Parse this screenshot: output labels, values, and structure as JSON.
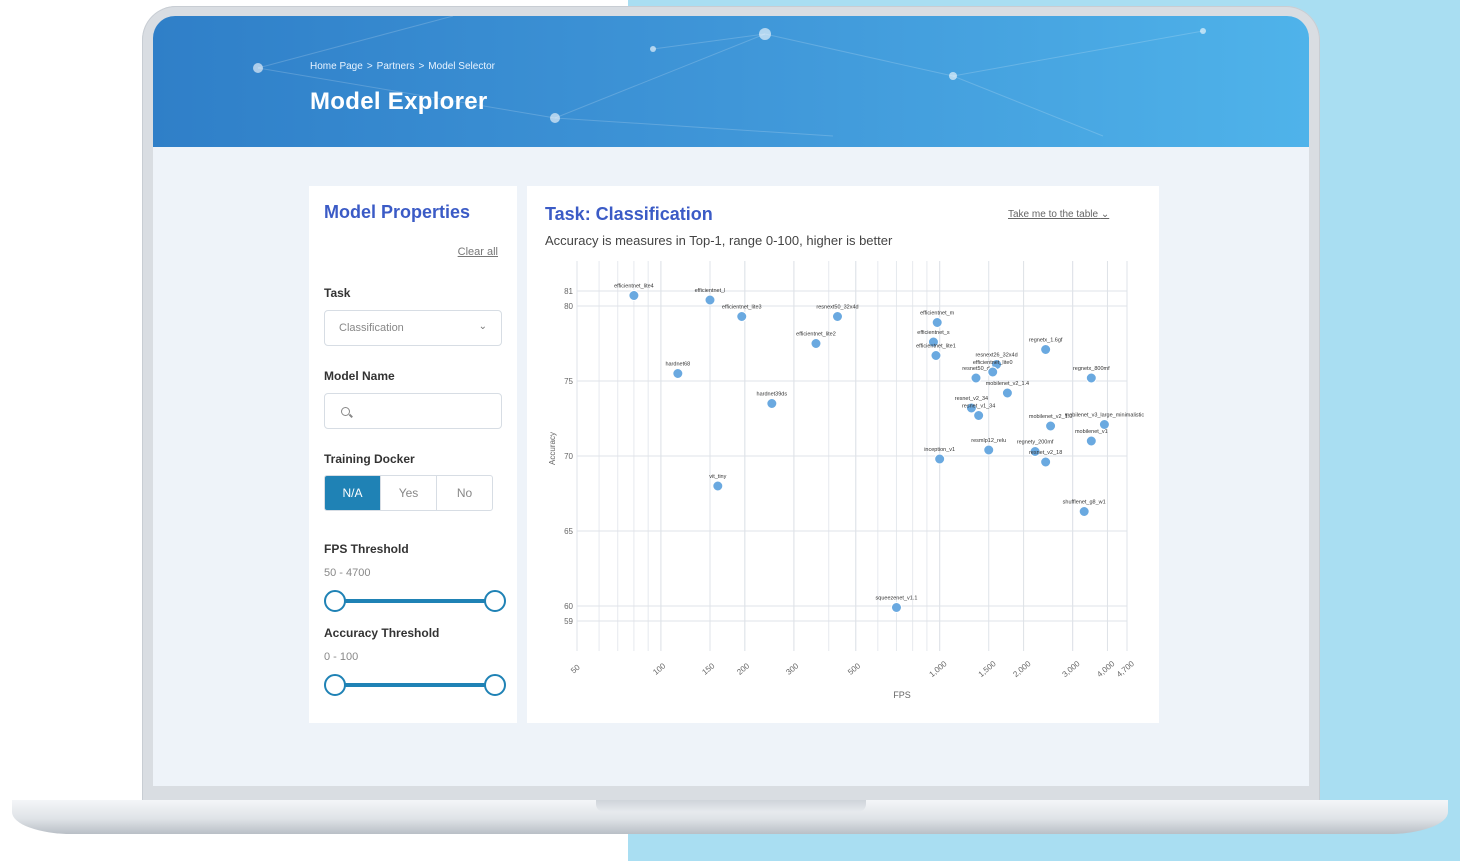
{
  "header": {
    "breadcrumb": [
      "Home Page",
      ">",
      "Partners",
      ">",
      "Model Selector"
    ],
    "title": "Model Explorer"
  },
  "sidebar": {
    "title": "Model Properties",
    "clear_all": "Clear all",
    "task_label": "Task",
    "task_value": "Classification",
    "model_name_label": "Model Name",
    "training_docker_label": "Training Docker",
    "docker_options": [
      "N/A",
      "Yes",
      "No"
    ],
    "docker_selected": "N/A",
    "fps_label": "FPS Threshold",
    "fps_range": "50 - 4700",
    "fps_min": 50,
    "fps_max": 4700,
    "accuracy_label": "Accuracy Threshold",
    "accuracy_range": "0 - 100",
    "accuracy_min": 0,
    "accuracy_max": 100
  },
  "main": {
    "task_title": "Task: Classification",
    "table_link": "Take me to the table",
    "subtitle": "Accuracy is measures in Top-1, range 0-100, higher is better"
  },
  "colors": {
    "accent": "#3b5bc6",
    "primary": "#1f82b5",
    "point": "#6aa9e0"
  },
  "icons": [
    "chevron-down-icon",
    "search-icon"
  ],
  "chart_data": {
    "type": "scatter",
    "xlabel": "FPS",
    "ylabel": "Accuracy",
    "x_scale": "log",
    "xlim": [
      50,
      4700
    ],
    "ylim": [
      57,
      82
    ],
    "x_ticks": [
      50,
      100,
      150,
      200,
      300,
      500,
      1000,
      1500,
      2000,
      3000,
      4000,
      4700
    ],
    "x_tick_labels": [
      "50",
      "100",
      "150",
      "200",
      "300",
      "500",
      "1,000",
      "1,500",
      "2,000",
      "3,000",
      "4,000",
      "4,700"
    ],
    "y_ticks": [
      59,
      60,
      65,
      70,
      75,
      80,
      81
    ],
    "grid": true,
    "points": [
      {
        "name": "efficientnet_lite4",
        "x": 80,
        "y": 80.7
      },
      {
        "name": "efficientnet_l",
        "x": 150,
        "y": 80.4
      },
      {
        "name": "efficientnet_lite3",
        "x": 195,
        "y": 79.3
      },
      {
        "name": "resnext50_32x4d",
        "x": 430,
        "y": 79.3
      },
      {
        "name": "efficientnet_lite2",
        "x": 360,
        "y": 77.5
      },
      {
        "name": "efficientnet_m",
        "x": 980,
        "y": 78.9
      },
      {
        "name": "efficientnet_s",
        "x": 950,
        "y": 77.6
      },
      {
        "name": "efficientnet_lite1",
        "x": 970,
        "y": 76.7
      },
      {
        "name": "hardnet68",
        "x": 115,
        "y": 75.5
      },
      {
        "name": "resnext26_32x4d",
        "x": 1600,
        "y": 76.1
      },
      {
        "name": "regnetx_1.6gf",
        "x": 2400,
        "y": 77.1
      },
      {
        "name": "regnetx_800mf",
        "x": 3500,
        "y": 75.2
      },
      {
        "name": "resnet50_d",
        "x": 1350,
        "y": 75.2
      },
      {
        "name": "efficientnet_lite0",
        "x": 1550,
        "y": 75.6
      },
      {
        "name": "mobilenet_v2_1.4",
        "x": 1750,
        "y": 74.2
      },
      {
        "name": "hardnet39ds",
        "x": 250,
        "y": 73.5
      },
      {
        "name": "resnet_v2_34",
        "x": 1300,
        "y": 73.2
      },
      {
        "name": "resnet_v1_34",
        "x": 1380,
        "y": 72.7
      },
      {
        "name": "mobilenet_v2_1.0",
        "x": 2500,
        "y": 72.0
      },
      {
        "name": "mobilenet_v3_large_minimalistic",
        "x": 3900,
        "y": 72.1
      },
      {
        "name": "mobilenet_v1",
        "x": 3500,
        "y": 71.0
      },
      {
        "name": "inception_v1",
        "x": 1000,
        "y": 69.8
      },
      {
        "name": "resmlp12_relu",
        "x": 1500,
        "y": 70.4
      },
      {
        "name": "regnety_200mf",
        "x": 2200,
        "y": 70.3
      },
      {
        "name": "resnet_v2_18",
        "x": 2400,
        "y": 69.6
      },
      {
        "name": "vit_tiny",
        "x": 160,
        "y": 68.0
      },
      {
        "name": "shufflenet_g8_w1",
        "x": 3300,
        "y": 66.3
      },
      {
        "name": "squeezenet_v1.1",
        "x": 700,
        "y": 59.9
      }
    ]
  }
}
